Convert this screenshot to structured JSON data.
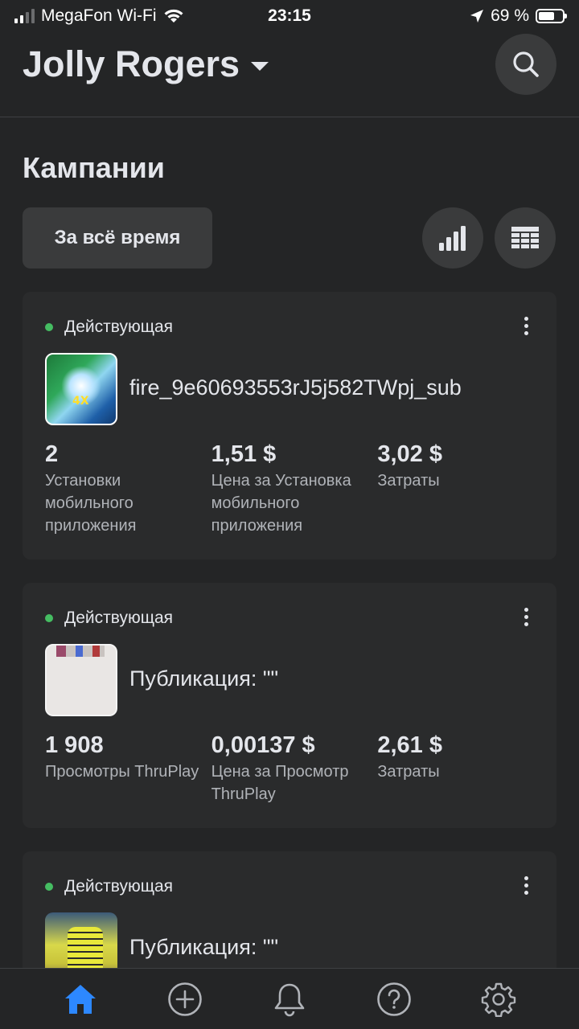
{
  "status_bar": {
    "carrier": "MegaFon Wi-Fi",
    "time": "23:15",
    "battery": "69 %",
    "battery_level": 0.69
  },
  "header": {
    "account_name": "Jolly Rogers",
    "search_icon": "search-icon"
  },
  "section": {
    "title": "Кампании"
  },
  "toolbar": {
    "date_filter_label": "За всё время",
    "chart_icon": "bar-chart-icon",
    "table_icon": "table-icon"
  },
  "campaigns": [
    {
      "status": "Действующая",
      "status_color": "#45bd62",
      "name": "fire_9e60693553rJ5j582TWpj_sub",
      "thumbnail_label": "4X",
      "metrics": [
        {
          "value": "2",
          "label": "Установки мобильного приложения"
        },
        {
          "value": "1,51 $",
          "label": "Цена за Установка мобильного приложения"
        },
        {
          "value": "3,02 $",
          "label": "Затраты"
        }
      ]
    },
    {
      "status": "Действующая",
      "status_color": "#45bd62",
      "name": "Публикация: \"\"",
      "metrics": [
        {
          "value": "1 908",
          "label": "Просмотры ThruPlay"
        },
        {
          "value": "0,00137 $",
          "label": "Цена за Просмотр ThruPlay"
        },
        {
          "value": "2,61 $",
          "label": "Затраты"
        }
      ]
    },
    {
      "status": "Действующая",
      "status_color": "#45bd62",
      "name": "Публикация: \"\""
    }
  ],
  "tab_bar": {
    "tabs": [
      {
        "icon": "home-icon",
        "active": true
      },
      {
        "icon": "plus-circle-icon",
        "active": false
      },
      {
        "icon": "bell-icon",
        "active": false
      },
      {
        "icon": "help-icon",
        "active": false
      },
      {
        "icon": "gear-icon",
        "active": false
      }
    ],
    "active_color": "#2d88ff",
    "inactive_color": "#b0b3b8"
  }
}
